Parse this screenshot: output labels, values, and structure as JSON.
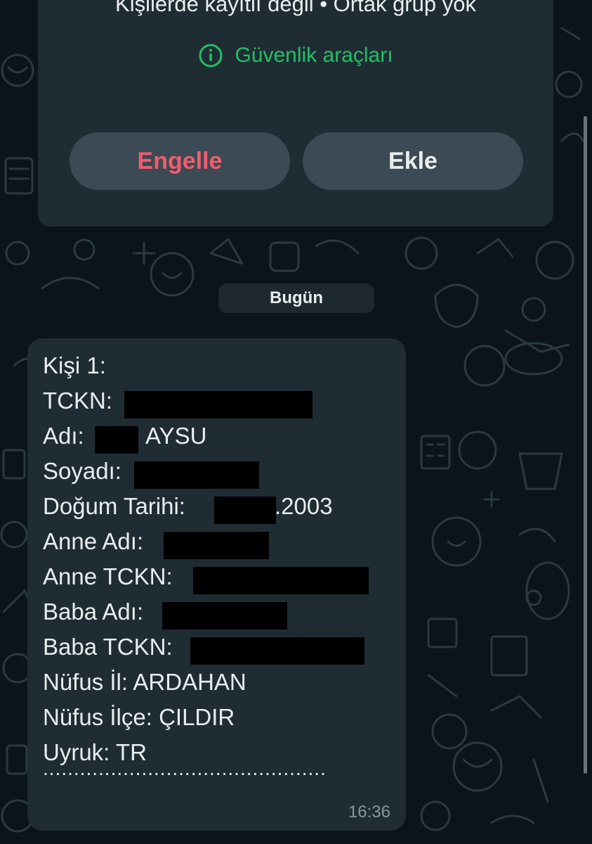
{
  "header": {
    "info_text": "Kişilerde kayıtlı değil • Ortak grup yok",
    "security_label": "Güvenlik araçları",
    "block_button": "Engelle",
    "add_button": "Ekle"
  },
  "date_chip": "Bugün",
  "message": {
    "lines": {
      "person": "Kişi 1:",
      "tckn_label": "TCKN:",
      "first_name_label": "Adı:",
      "first_name_visible": "AYSU",
      "surname_label": "Soyadı:",
      "birth_label": "Doğum Tarihi:",
      "birth_year_visible": ".2003",
      "mother_name_label": "Anne Adı:",
      "mother_tckn_label": "Anne TCKN:",
      "father_name_label": "Baba Adı:",
      "father_tckn_label": "Baba TCKN:",
      "province": "Nüfus İl: ARDAHAN",
      "district": "Nüfus İlçe: ÇILDIR",
      "nationality": "Uyruk: TR"
    },
    "dots": "..............................................",
    "time": "16:36"
  },
  "colors": {
    "background": "#0b141a",
    "card": "#1f2c34",
    "button": "#3b4a54",
    "accent_green": "#21c063",
    "danger_red": "#f15c6d",
    "timestamp": "#8696a0"
  },
  "icons": {
    "security": "info-circle-icon"
  }
}
